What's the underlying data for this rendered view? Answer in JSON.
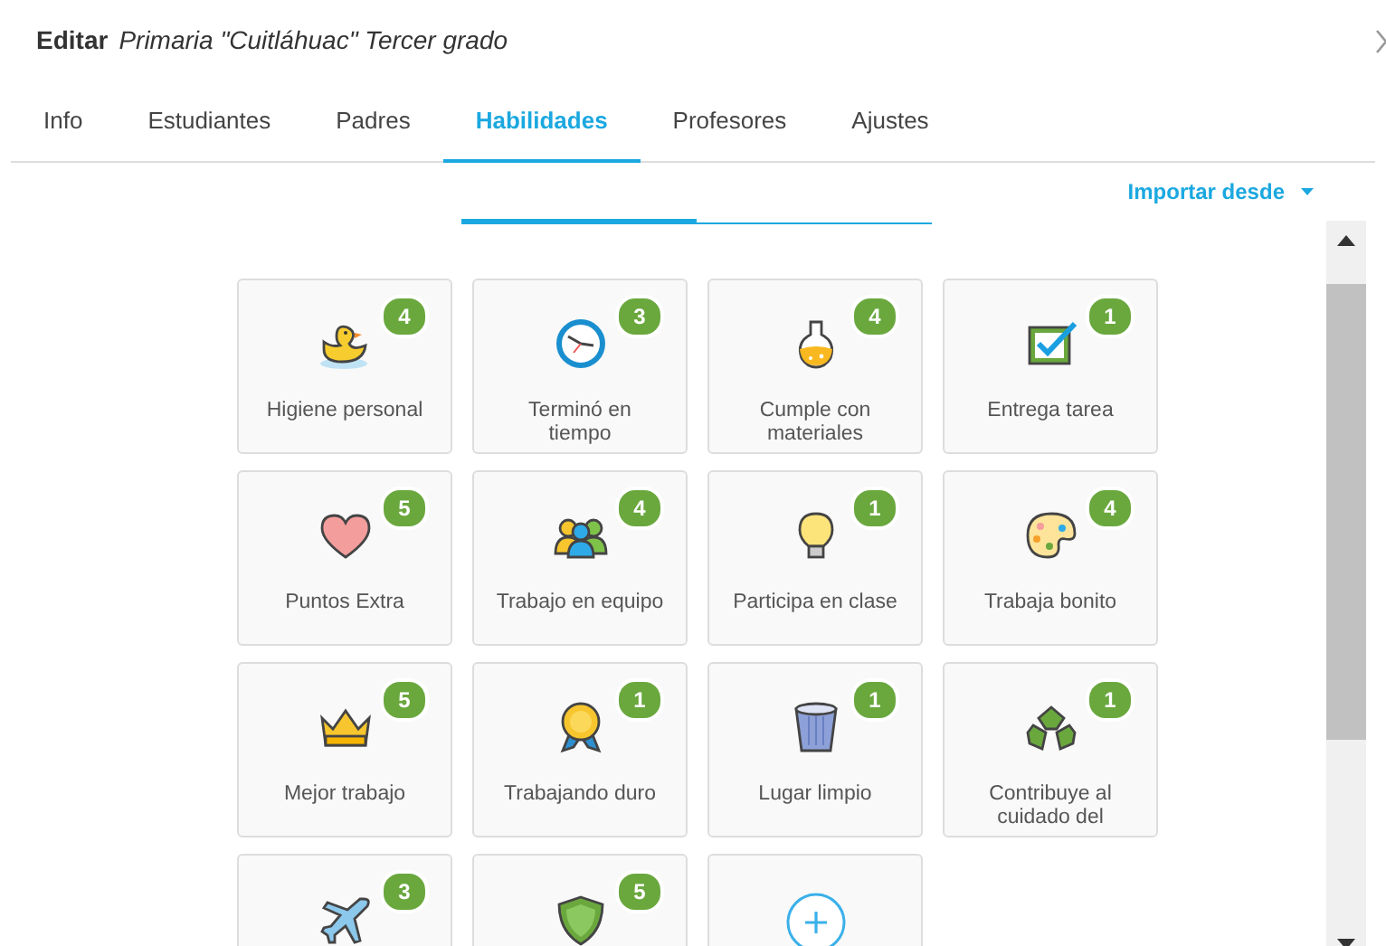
{
  "window": {
    "title_prefix": "Editar",
    "title": "Primaria \"Cuitláhuac\" Tercer grado"
  },
  "tabs": [
    {
      "label": "Info",
      "selected": false
    },
    {
      "label": "Estudiantes",
      "selected": false
    },
    {
      "label": "Padres",
      "selected": false
    },
    {
      "label": "Habilidades",
      "selected": true
    },
    {
      "label": "Profesores",
      "selected": false
    },
    {
      "label": "Ajustes",
      "selected": false
    }
  ],
  "import_menu": {
    "label": "Importar desde"
  },
  "skills": [
    {
      "kind": "skill",
      "label": "Higiene personal",
      "count": "4"
    },
    {
      "kind": "skill",
      "label": "Terminó en tiempo",
      "count": "3"
    },
    {
      "kind": "skill",
      "label": "Cumple con materiales",
      "count": "4"
    },
    {
      "kind": "skill",
      "label": "Entrega tarea",
      "count": "1"
    },
    {
      "kind": "skill",
      "label": "Puntos Extra",
      "count": "5"
    },
    {
      "kind": "skill",
      "label": "Trabajo en equipo",
      "count": "4"
    },
    {
      "kind": "skill",
      "label": "Participa en clase",
      "count": "1"
    },
    {
      "kind": "skill",
      "label": "Trabaja bonito",
      "count": "4"
    },
    {
      "kind": "skill",
      "label": "Mejor trabajo",
      "count": "5"
    },
    {
      "kind": "skill",
      "label": "Trabajando duro",
      "count": "1"
    },
    {
      "kind": "skill",
      "label": "Lugar limpio",
      "count": "1"
    },
    {
      "kind": "skill",
      "label": "Contribuye al cuidado del",
      "count": "1"
    },
    {
      "kind": "skill",
      "count": "3"
    },
    {
      "kind": "skill",
      "count": "5"
    },
    {
      "kind": "add"
    }
  ]
}
